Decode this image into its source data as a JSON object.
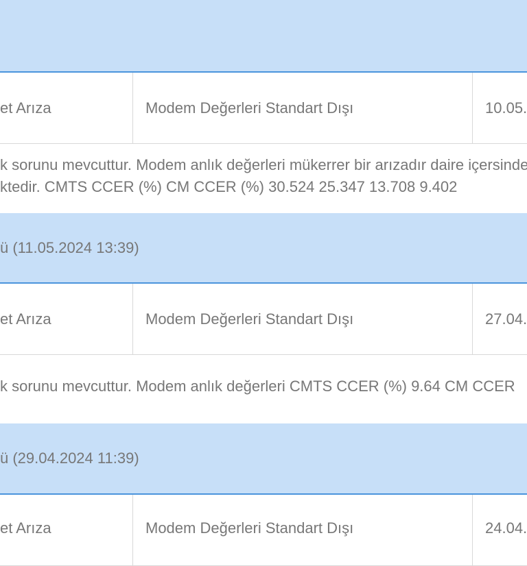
{
  "records": [
    {
      "header": "",
      "type": "et Arıza",
      "description": "Modem Değerleri Standart Dışı",
      "date": "10.05.",
      "note_lines": [
        "k sorunu mevcuttur. Modem anlık değerleri mükerrer bir arızadır daire içersinde",
        "ktedir. CMTS CCER (%) CM CCER (%) 30.524 25.347 13.708 9.402"
      ]
    },
    {
      "header": "ü  (11.05.2024 13:39)",
      "type": "et Arıza",
      "description": "Modem Değerleri Standart Dışı",
      "date": "27.04.",
      "note_lines": [
        "k sorunu mevcuttur. Modem anlık değerleri CMTS CCER (%) 9.64 CM CCER"
      ]
    },
    {
      "header": "ü  (29.04.2024 11:39)",
      "type": "et Arıza",
      "description": "Modem Değerleri Standart Dışı",
      "date": "24.04."
    }
  ]
}
